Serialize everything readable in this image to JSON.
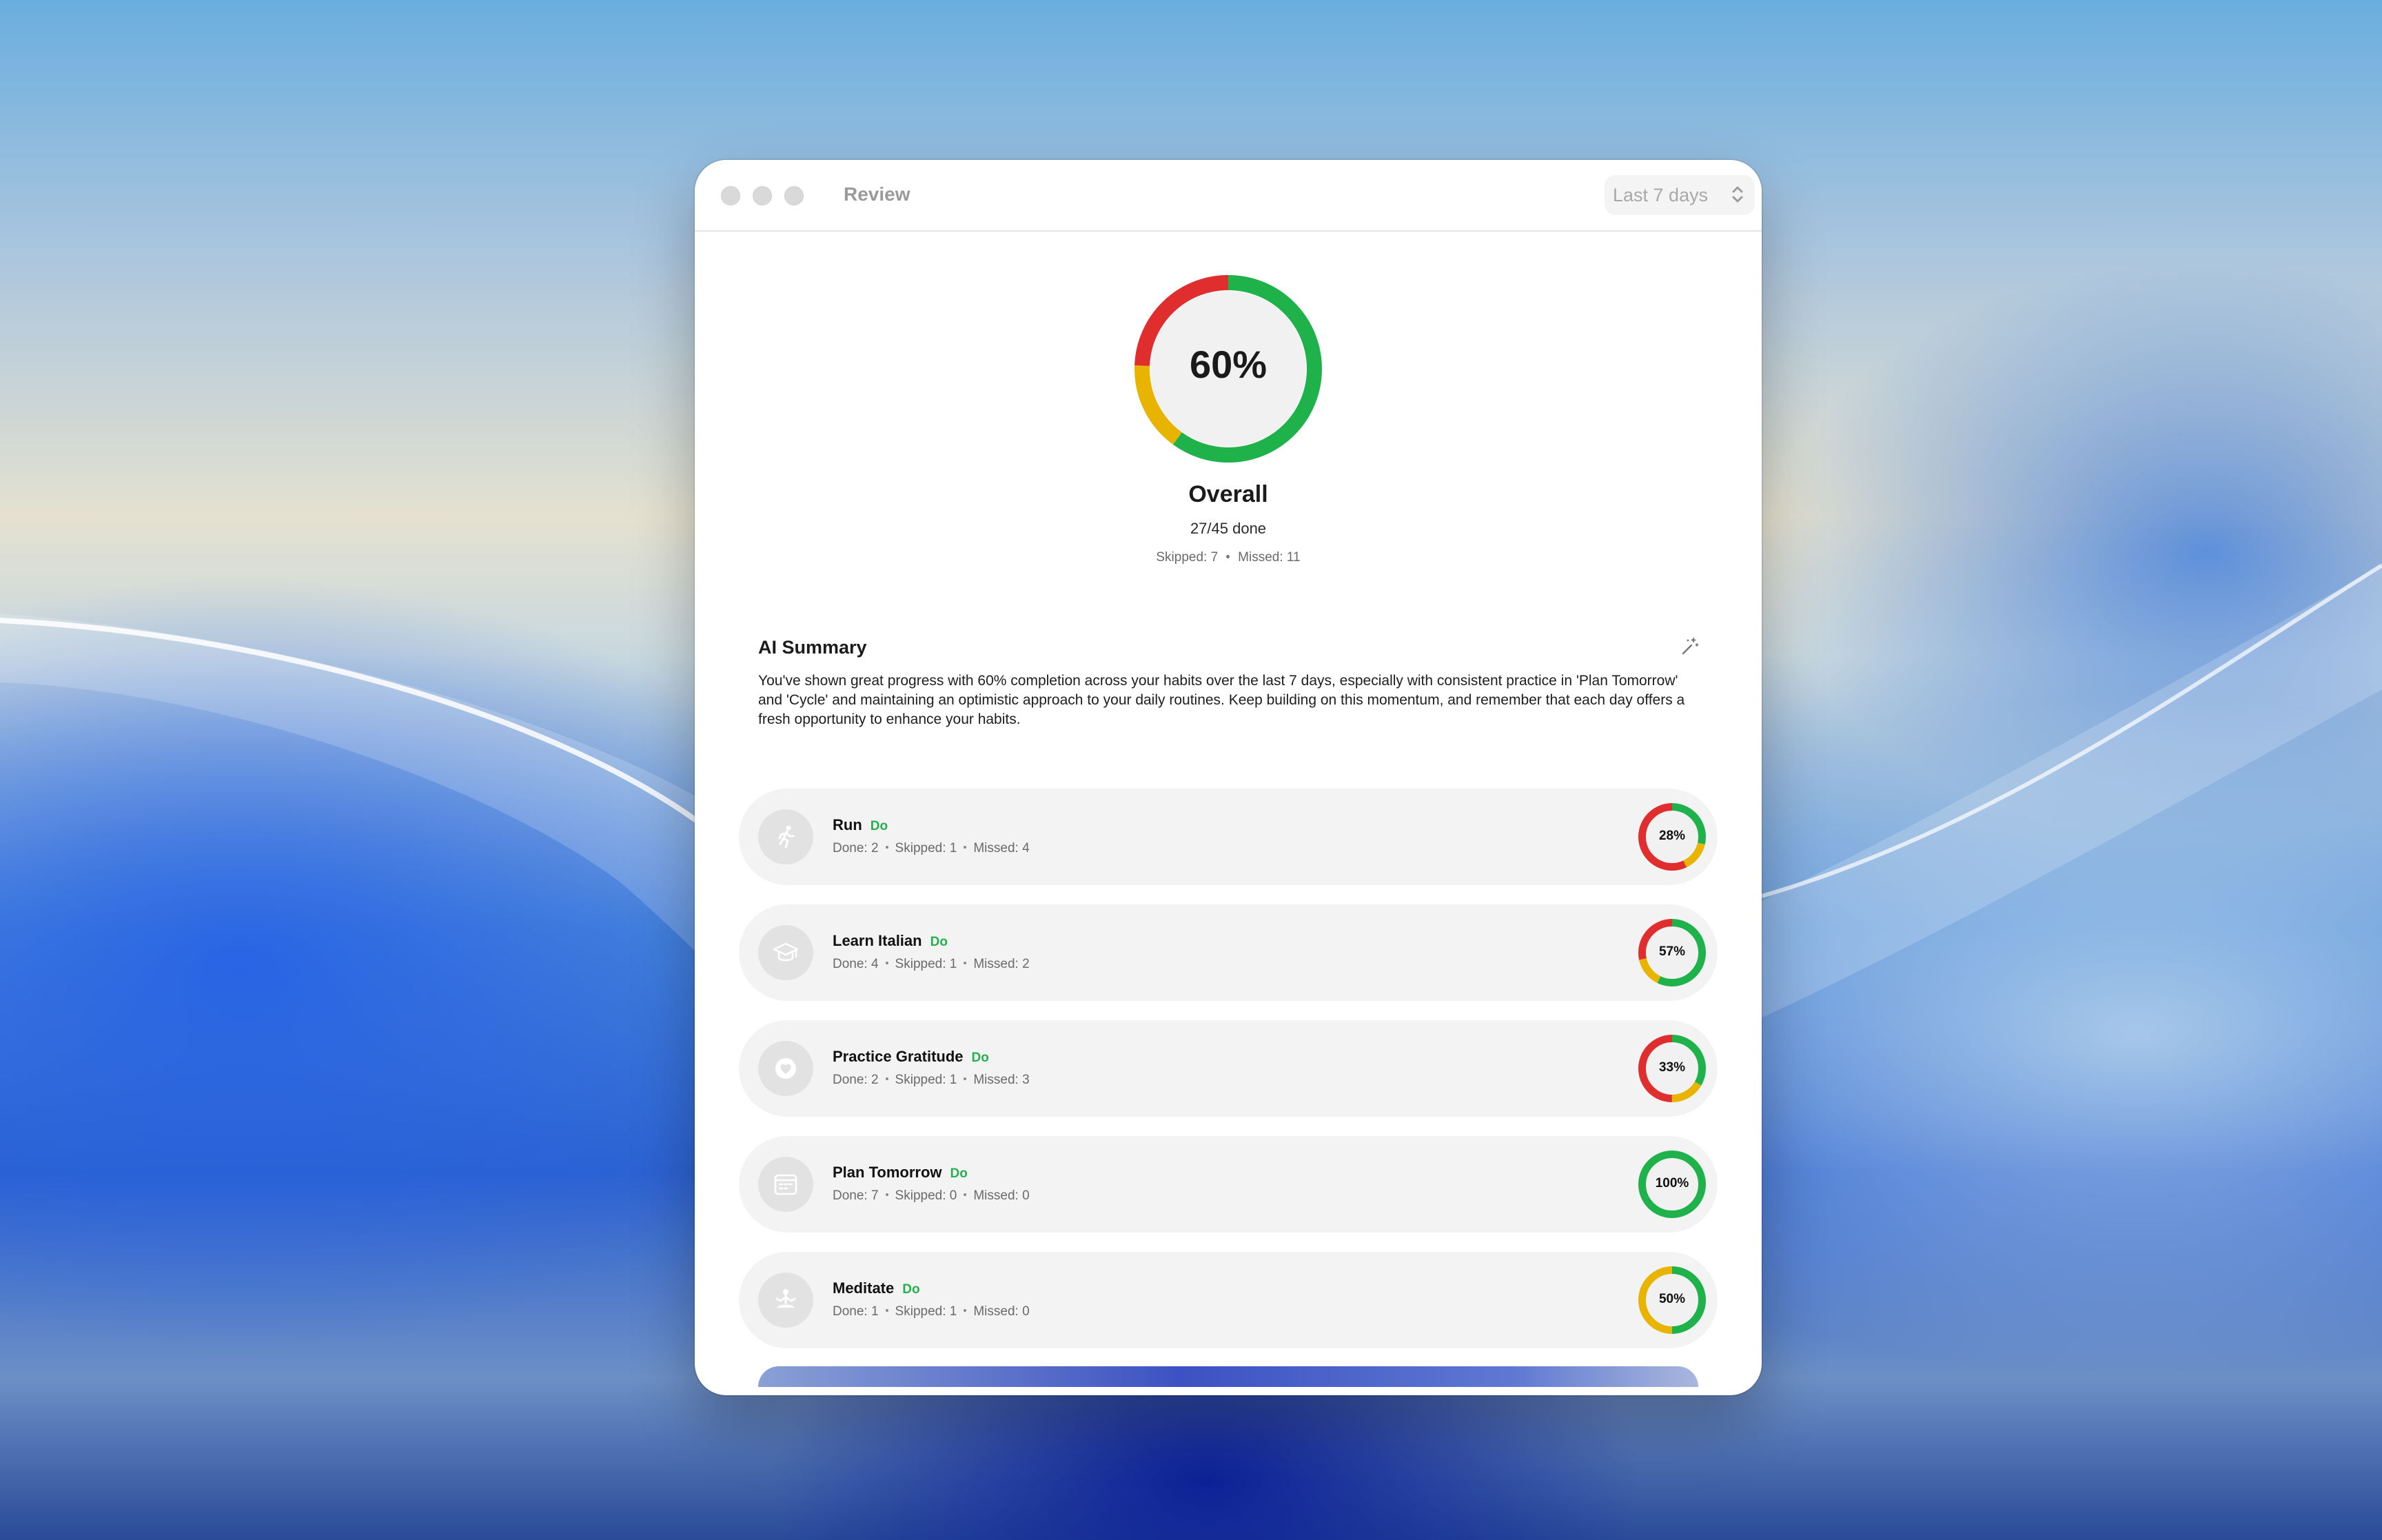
{
  "window": {
    "title": "Review",
    "period_selector": {
      "selected": "Last 7 days"
    }
  },
  "overall": {
    "percent_label": "60%",
    "title": "Overall",
    "done_text": "27/45 done",
    "skipped_text": "Skipped: 7",
    "missed_text": "Missed: 11",
    "done": 27,
    "skipped": 7,
    "missed": 11
  },
  "ai_summary": {
    "title": "AI Summary",
    "text": "You've shown great progress with 60% completion across your habits over the last 7 days, especially with consistent practice in 'Plan Tomorrow' and 'Cycle' and maintaining an optimistic approach to your daily routines. Keep building on this momentum, and remember that each day offers a fresh opportunity to enhance your habits."
  },
  "colors": {
    "done": "#1fb24a",
    "skipped": "#e8b400",
    "missed": "#e02d2d",
    "kind_label": "#23b14d"
  },
  "habits": [
    {
      "name": "Run",
      "kind": "Do",
      "icon": "running-figure-icon",
      "done_text": "Done: 2",
      "skipped_text": "Skipped: 1",
      "missed_text": "Missed: 4",
      "percent_label": "28%",
      "done": 2,
      "skipped": 1,
      "missed": 4
    },
    {
      "name": "Learn Italian",
      "kind": "Do",
      "icon": "graduation-cap-icon",
      "done_text": "Done: 4",
      "skipped_text": "Skipped: 1",
      "missed_text": "Missed: 2",
      "percent_label": "57%",
      "done": 4,
      "skipped": 1,
      "missed": 2
    },
    {
      "name": "Practice Gratitude",
      "kind": "Do",
      "icon": "heart-icon",
      "done_text": "Done: 2",
      "skipped_text": "Skipped: 1",
      "missed_text": "Missed: 3",
      "percent_label": "33%",
      "done": 2,
      "skipped": 1,
      "missed": 3
    },
    {
      "name": "Plan Tomorrow",
      "kind": "Do",
      "icon": "calendar-icon",
      "done_text": "Done: 7",
      "skipped_text": "Skipped: 0",
      "missed_text": "Missed: 0",
      "percent_label": "100%",
      "done": 7,
      "skipped": 0,
      "missed": 0
    },
    {
      "name": "Meditate",
      "kind": "Do",
      "icon": "meditation-figure-icon",
      "done_text": "Done: 1",
      "skipped_text": "Skipped: 1",
      "missed_text": "Missed: 0",
      "percent_label": "50%",
      "done": 1,
      "skipped": 1,
      "missed": 0
    }
  ]
}
